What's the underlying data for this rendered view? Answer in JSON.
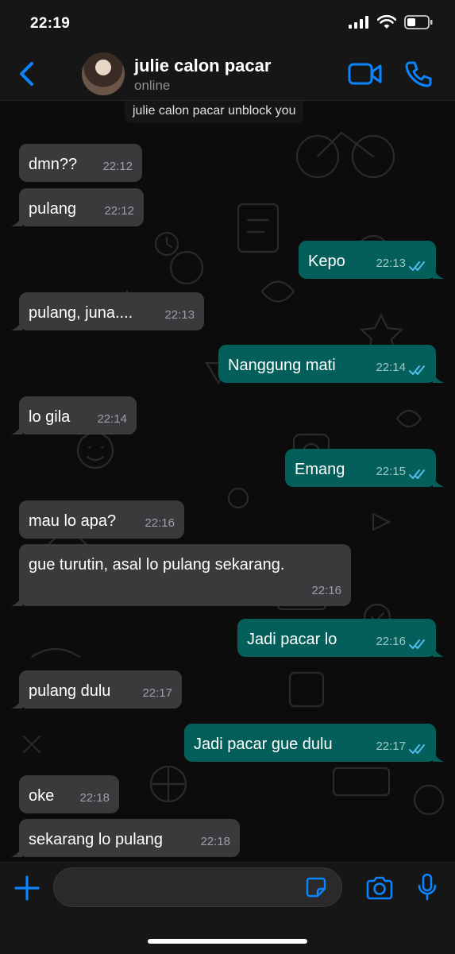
{
  "status_bar": {
    "time": "22:19"
  },
  "header": {
    "contact_name": "julie calon pacar",
    "contact_status": "online"
  },
  "system_note": "julie calon pacar unblock you",
  "messages": [
    {
      "dir": "in",
      "text": "dmn??",
      "time": "22:12"
    },
    {
      "dir": "in",
      "text": "pulang",
      "time": "22:12"
    },
    {
      "dir": "out",
      "text": "Kepo",
      "time": "22:13"
    },
    {
      "dir": "in",
      "text": "pulang, juna....",
      "time": "22:13"
    },
    {
      "dir": "out",
      "text": "Nanggung mati",
      "time": "22:14"
    },
    {
      "dir": "in",
      "text": "lo gila",
      "time": "22:14"
    },
    {
      "dir": "out",
      "text": "Emang",
      "time": "22:15"
    },
    {
      "dir": "in",
      "text": "mau lo apa?",
      "time": "22:16"
    },
    {
      "dir": "in",
      "text": "gue turutin, asal lo pulang sekarang.",
      "time": "22:16"
    },
    {
      "dir": "out",
      "text": "Jadi pacar lo",
      "time": "22:16"
    },
    {
      "dir": "in",
      "text": "pulang dulu",
      "time": "22:17"
    },
    {
      "dir": "out",
      "text": "Jadi pacar gue dulu",
      "time": "22:17"
    },
    {
      "dir": "in",
      "text": "oke",
      "time": "22:18"
    },
    {
      "dir": "in",
      "text": "sekarang lo pulang",
      "time": "22:18"
    }
  ],
  "composer": {
    "input_value": ""
  },
  "colors": {
    "accent": "#0a84ff",
    "incoming_bubble": "#3a3a3c",
    "outgoing_bubble": "#045f5a",
    "read_ticks": "#53bdeb"
  },
  "icons": [
    "back-chevron-icon",
    "video-call-icon",
    "phone-call-icon",
    "plus-icon",
    "sticker-icon",
    "camera-icon",
    "microphone-icon",
    "read-ticks-icon"
  ]
}
